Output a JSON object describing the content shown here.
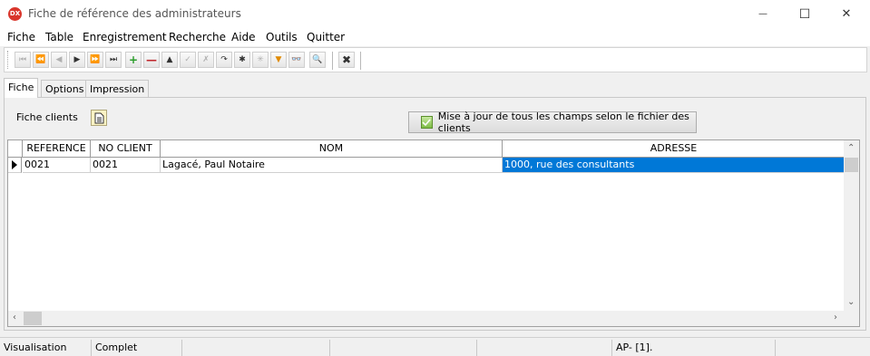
{
  "window": {
    "app_icon_text": "DX",
    "title": "Fiche de référence des administrateurs",
    "minimize_glyph": "—",
    "maximize_glyph": "☐",
    "close_glyph": "✕"
  },
  "menu": [
    "Fiche",
    "Table",
    "Enregistrement",
    "Recherche",
    "Aide",
    "Outils",
    "Quitter"
  ],
  "toolbar": {
    "buttons": [
      {
        "icon": "first-record-icon",
        "glyph": "⏮",
        "enabled": false
      },
      {
        "icon": "prior-page-icon",
        "glyph": "⏪",
        "enabled": false
      },
      {
        "icon": "prior-record-icon",
        "glyph": "◀",
        "enabled": false
      },
      {
        "icon": "next-record-icon",
        "glyph": "▶",
        "enabled": true
      },
      {
        "icon": "next-page-icon",
        "glyph": "⏩",
        "enabled": true
      },
      {
        "icon": "last-record-icon",
        "glyph": "⏭",
        "enabled": true
      },
      {
        "icon": "insert-icon",
        "glyph": "+",
        "enabled": true,
        "color": "#2a9d2a"
      },
      {
        "icon": "delete-icon",
        "glyph": "—",
        "enabled": true,
        "color": "#c0282d"
      },
      {
        "icon": "edit-icon",
        "glyph": "▲",
        "enabled": true
      },
      {
        "icon": "post-icon",
        "glyph": "✓",
        "enabled": false
      },
      {
        "icon": "cancel-icon",
        "glyph": "✗",
        "enabled": false
      },
      {
        "icon": "refresh-icon",
        "glyph": "↷",
        "enabled": true
      },
      {
        "icon": "bookmark-icon",
        "glyph": "✱",
        "enabled": true
      },
      {
        "icon": "goto-bookmark-icon",
        "glyph": "✳",
        "enabled": false
      },
      {
        "icon": "filter-icon",
        "glyph": "▼",
        "enabled": true,
        "color": "#e08a00"
      },
      {
        "icon": "binoculars-icon",
        "glyph": "👓",
        "enabled": true,
        "color": "#2a5aa8"
      },
      {
        "icon": "search-icon",
        "glyph": "🔍",
        "enabled": true
      },
      {
        "icon": "close-table-icon",
        "glyph": "✖",
        "enabled": true
      }
    ]
  },
  "tabs": [
    "Fiche",
    "Options",
    "Impression"
  ],
  "active_tab": "Fiche",
  "panel": {
    "label": "Fiche clients",
    "update_button_label": "Mise à jour de tous les champs selon le fichier des clients"
  },
  "grid": {
    "columns": [
      "REFERENCE",
      "NO CLIENT",
      "NOM",
      "ADRESSE"
    ],
    "rows": [
      [
        "0021",
        "0021",
        "Lagacé, Paul Notaire",
        "1000, rue des consultants"
      ]
    ],
    "selected_column": "ADRESSE",
    "selection_color": "#0078d7"
  },
  "status": [
    "Visualisation",
    "Complet",
    "",
    "",
    "",
    "AP- [1].",
    ""
  ]
}
